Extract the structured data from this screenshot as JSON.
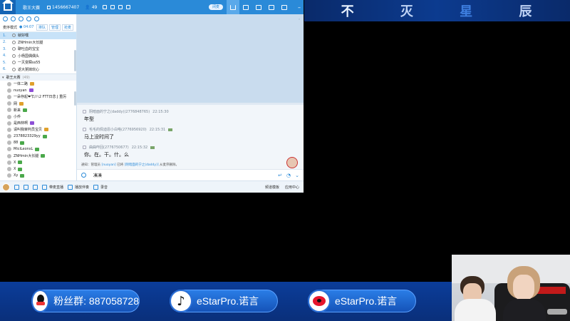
{
  "banner": {
    "chars": [
      "不",
      "灭",
      "星",
      "辰"
    ]
  },
  "qq": {
    "title": "歌王大赛",
    "id": "1456667407",
    "users": "49",
    "toggle": "闭麦",
    "mic_header": {
      "label": "麦序模式",
      "status": "● 04:07",
      "buttons": [
        "排队",
        "管理",
        "抢麦"
      ]
    },
    "queue": [
      {
        "num": "1.",
        "name": "就好嘿"
      },
      {
        "num": "2.",
        "name": "ZNHmin大长腿"
      },
      {
        "num": "3.",
        "name": "聊吐血的宝宝"
      },
      {
        "num": "4.",
        "name": "小杨国偶偶头"
      },
      {
        "num": "5.",
        "name": "一灭变瞬ss55"
      },
      {
        "num": "6.",
        "name": "返大粥妹欢心"
      }
    ],
    "channel": {
      "name": "歌王大赛",
      "count": "(49)"
    },
    "members": [
      {
        "name": "一体二路",
        "badge": "gold"
      },
      {
        "name": "nuoyan",
        "badge": "purple"
      },
      {
        "name": "一朵存起❤乍/八2 FTT日念 J 重厉",
        "badge": ""
      },
      {
        "name": "网",
        "badge": "gold"
      },
      {
        "name": "新来",
        "badge": "green"
      },
      {
        "name": "小乔",
        "badge": ""
      },
      {
        "name": "是西林啊",
        "badge": "purple"
      },
      {
        "name": "请叫我审判员宝贝",
        "badge": "gold"
      },
      {
        "name": "2378823329yy",
        "badge": "green"
      },
      {
        "name": "88",
        "badge": "green"
      },
      {
        "name": "MiciLeonsL",
        "badge": "green"
      },
      {
        "name": "ZNHmin大长腿",
        "badge": "green"
      },
      {
        "name": "X",
        "badge": "green"
      },
      {
        "name": "X",
        "badge": "green"
      },
      {
        "name": "Xy",
        "badge": "green"
      }
    ],
    "messages": [
      {
        "sender": "阴暗面的宁之(daddy)(2776848765)",
        "time": "22:15:30",
        "text": "年型"
      },
      {
        "sender": "毛毛的佩迪恩小白咯(2776956920)",
        "time": "22:15:31",
        "text": "马上没时间了"
      },
      {
        "sender": "曲曲咋回(2776750677)",
        "time": "22:15:32",
        "text": "你。在。干。什。么"
      }
    ],
    "notice": {
      "prefix": "通知：管理员",
      "actor": "[nuoyan]",
      "mid": "已将",
      "target": "[阴暗面的宁之(daddy)]",
      "suffix": "从麦序删除。"
    },
    "input_text": "凑凑",
    "bottom": {
      "items": [
        "带麦直播",
        "播放伴奏",
        "录音"
      ],
      "right": [
        "频道模板",
        "应用中心"
      ]
    }
  },
  "social": [
    {
      "icon": "qq-icon",
      "text": "粉丝群: 887058728"
    },
    {
      "icon": "tiktok-icon",
      "text": "eStarPro.诺言"
    },
    {
      "icon": "weibo-icon",
      "text": "eStarPro.诺言"
    }
  ],
  "colors": {
    "accent": "#2a8ad8",
    "strip": "#0b3d9a"
  }
}
